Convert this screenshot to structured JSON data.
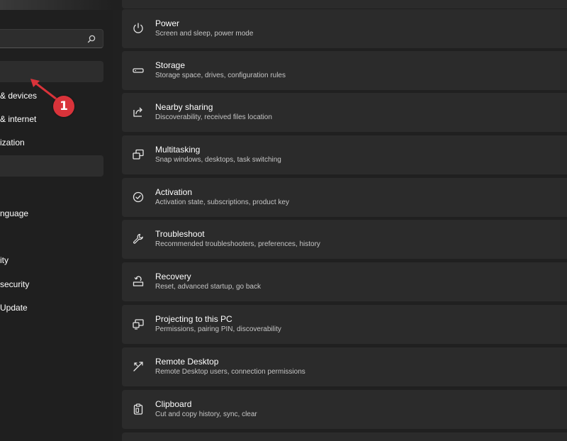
{
  "sidebar": {
    "search": {
      "placeholder": ""
    },
    "items": [
      {
        "label": "",
        "state": "selected"
      },
      {
        "label": "& devices",
        "state": "normal"
      },
      {
        "label": "& internet",
        "state": "normal"
      },
      {
        "label": "ization",
        "state": "normal"
      },
      {
        "label": "",
        "state": "hovered"
      },
      {
        "label": "",
        "state": "normal"
      },
      {
        "label": "nguage",
        "state": "normal"
      },
      {
        "label": "ity",
        "state": "normal"
      },
      {
        "label": "security",
        "state": "normal"
      },
      {
        "label": "Update",
        "state": "normal"
      }
    ]
  },
  "annotation": {
    "number": "1",
    "color": "#d9333a"
  },
  "cards": [
    {
      "title": "Power",
      "subtitle": "Screen and sleep, power mode",
      "icon": "power-icon"
    },
    {
      "title": "Storage",
      "subtitle": "Storage space, drives, configuration rules",
      "icon": "storage-icon"
    },
    {
      "title": "Nearby sharing",
      "subtitle": "Discoverability, received files location",
      "icon": "share-icon"
    },
    {
      "title": "Multitasking",
      "subtitle": "Snap windows, desktops, task switching",
      "icon": "multitasking-icon"
    },
    {
      "title": "Activation",
      "subtitle": "Activation state, subscriptions, product key",
      "icon": "check-circle-icon"
    },
    {
      "title": "Troubleshoot",
      "subtitle": "Recommended troubleshooters, preferences, history",
      "icon": "wrench-icon"
    },
    {
      "title": "Recovery",
      "subtitle": "Reset, advanced startup, go back",
      "icon": "recovery-icon"
    },
    {
      "title": "Projecting to this PC",
      "subtitle": "Permissions, pairing PIN, discoverability",
      "icon": "projecting-icon"
    },
    {
      "title": "Remote Desktop",
      "subtitle": "Remote Desktop users, connection permissions",
      "icon": "remote-desktop-icon"
    },
    {
      "title": "Clipboard",
      "subtitle": "Cut and copy history, sync, clear",
      "icon": "clipboard-icon"
    }
  ]
}
